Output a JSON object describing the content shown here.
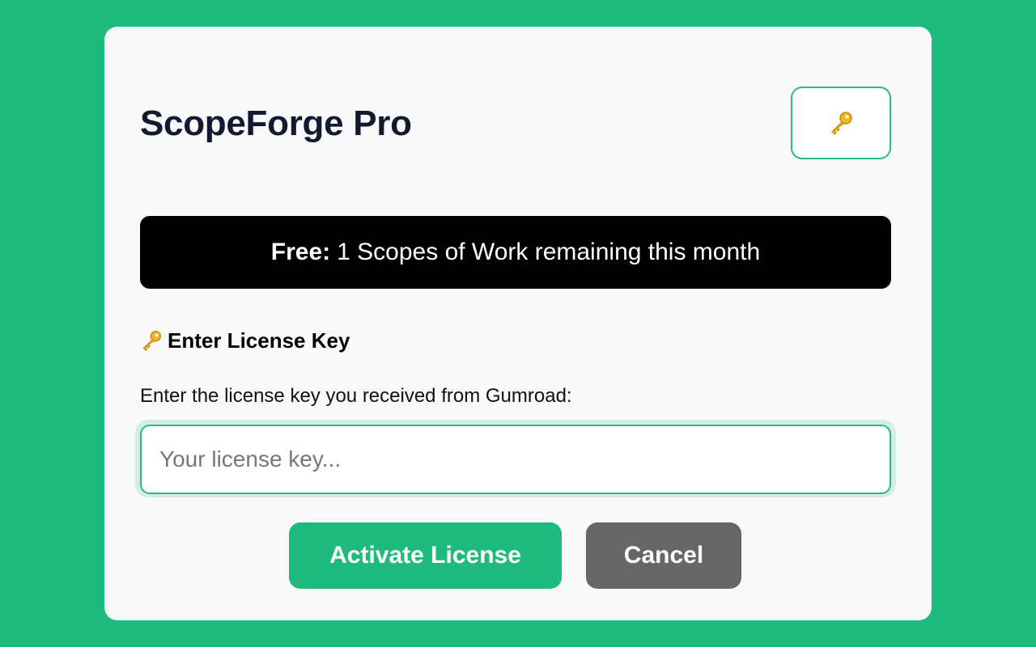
{
  "header": {
    "title": "ScopeForge Pro",
    "key_button_icon": "key-icon"
  },
  "status": {
    "prefix": "Free:",
    "message": "1 Scopes of Work remaining this month"
  },
  "license": {
    "heading_icon": "key-icon",
    "heading": "Enter License Key",
    "instruction": "Enter the license key you received from Gumroad:",
    "input_value": "",
    "input_placeholder": "Your license key..."
  },
  "actions": {
    "activate_label": "Activate License",
    "cancel_label": "Cancel"
  },
  "colors": {
    "background": "#1fba7e",
    "accent": "#2cb98a",
    "banner": "#000000",
    "cancel": "#666666"
  }
}
